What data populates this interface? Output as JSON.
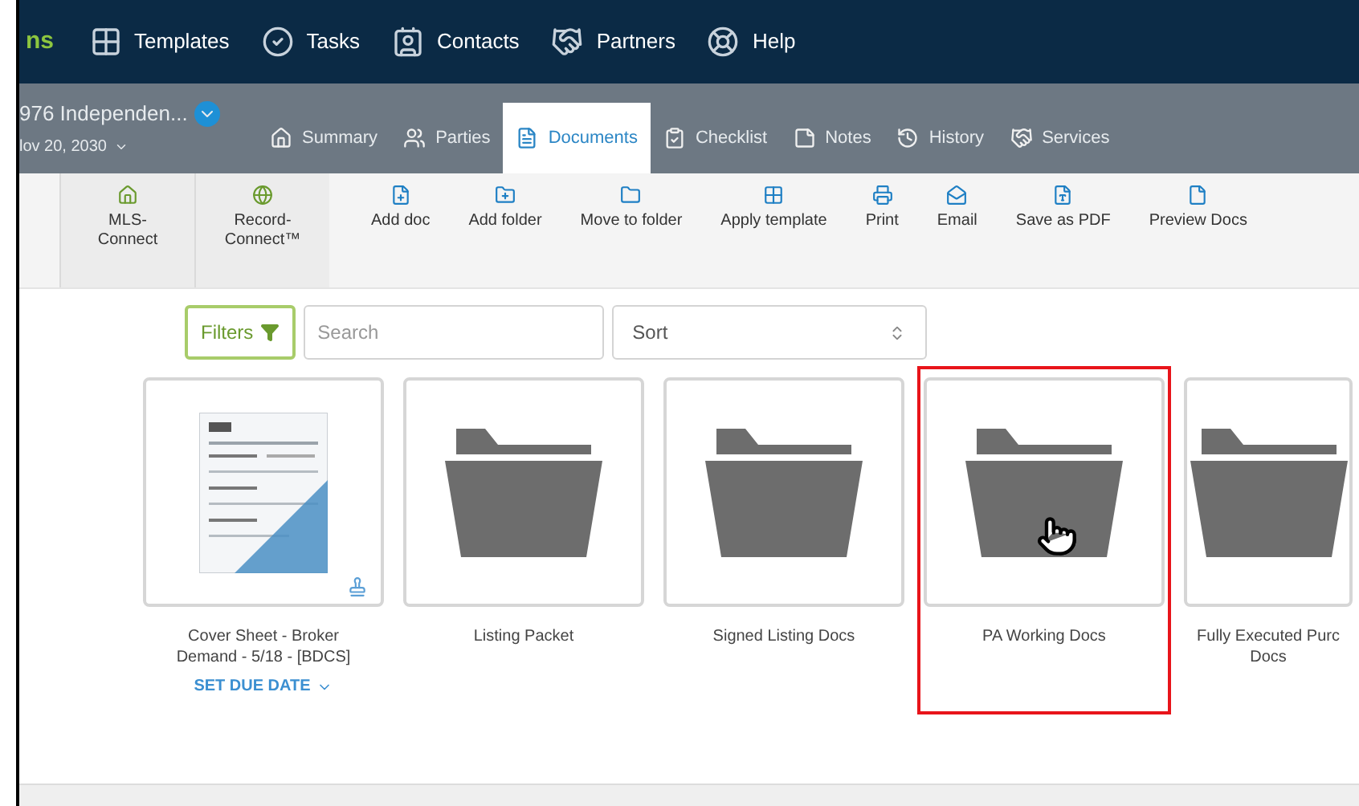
{
  "brand": {
    "text": "ns"
  },
  "top_nav": [
    {
      "label": "Templates"
    },
    {
      "label": "Tasks"
    },
    {
      "label": "Contacts"
    },
    {
      "label": "Partners"
    },
    {
      "label": "Help"
    }
  ],
  "transaction": {
    "address": "976 Independen...",
    "date": "lov 20, 2030"
  },
  "tabs": [
    {
      "label": "Summary",
      "selected": false
    },
    {
      "label": "Parties",
      "selected": false
    },
    {
      "label": "Documents",
      "selected": true
    },
    {
      "label": "Checklist",
      "selected": false
    },
    {
      "label": "Notes",
      "selected": false
    },
    {
      "label": "History",
      "selected": false
    },
    {
      "label": "Services",
      "selected": false
    }
  ],
  "toolbar": [
    {
      "label": "MLS-Connect",
      "kind": "connect"
    },
    {
      "label": "Record-Connect™",
      "kind": "connect"
    },
    {
      "label": "Add doc",
      "kind": "action"
    },
    {
      "label": "Add folder",
      "kind": "action"
    },
    {
      "label": "Move to folder",
      "kind": "action"
    },
    {
      "label": "Apply template",
      "kind": "action"
    },
    {
      "label": "Print",
      "kind": "action"
    },
    {
      "label": "Email",
      "kind": "action"
    },
    {
      "label": "Save as PDF",
      "kind": "action"
    },
    {
      "label": "Preview Docs",
      "kind": "action"
    }
  ],
  "filters_button": "Filters",
  "search": {
    "placeholder": "Search"
  },
  "sort": {
    "value": "Sort"
  },
  "items": [
    {
      "kind": "document",
      "label": "Cover Sheet - Broker Demand - 5/18 - [BDCS]",
      "due_date": "SET DUE DATE",
      "highlighted": false,
      "hovered": false
    },
    {
      "kind": "folder",
      "label": "Listing Packet",
      "highlighted": false,
      "hovered": false
    },
    {
      "kind": "folder",
      "label": "Signed Listing Docs",
      "highlighted": false,
      "hovered": false
    },
    {
      "kind": "folder",
      "label": "PA Working Docs",
      "highlighted": true,
      "hovered": true
    },
    {
      "kind": "folder",
      "label": "Fully Executed Purc Docs",
      "highlighted": false,
      "hovered": false
    }
  ]
}
